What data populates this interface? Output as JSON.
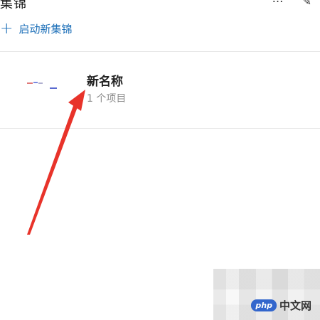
{
  "header": {
    "title": "集锦",
    "pin_icon": "pin-icon",
    "more_icon": "more-icon"
  },
  "actions": {
    "new_collection_label": "启动新集锦",
    "plus_icon": "plus-icon"
  },
  "collection": {
    "name": "新名称",
    "item_count": "1 个项目"
  },
  "annotation": {
    "arrow_color": "#e8332a"
  },
  "watermark": {
    "logo": "php",
    "text": "中文网"
  }
}
